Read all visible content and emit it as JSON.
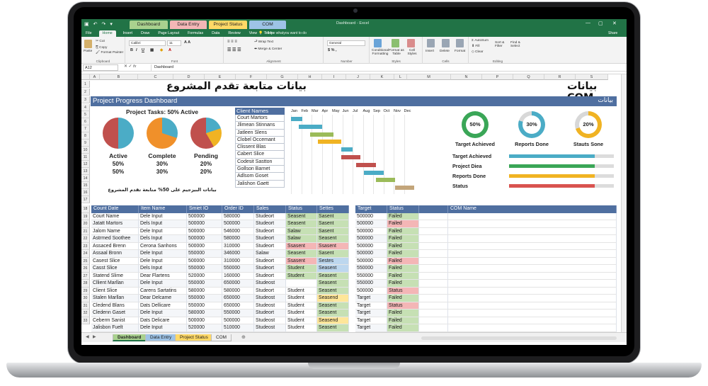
{
  "app": {
    "window_title": "Dashboard - Excel",
    "context_tabs": [
      {
        "label": "Dashboard",
        "color": "#a9d18e"
      },
      {
        "label": "Data Entry",
        "color": "#f4b6b6"
      },
      {
        "label": "Project Status",
        "color": "#ffd966"
      },
      {
        "label": "COM",
        "color": "#9dc3e6"
      }
    ],
    "user": "Share"
  },
  "menu": [
    "File",
    "Home",
    "Insert",
    "Draw",
    "Page Layout",
    "Formulas",
    "Data",
    "Review",
    "View",
    "Help"
  ],
  "menu_tell": "Tell me whatyou want to do",
  "ribbon": {
    "clipboard": {
      "label": "Clipboard",
      "paste": "Paste",
      "cut": "Cut",
      "copy": "Copy",
      "format_painter": "Format Painter"
    },
    "font": {
      "label": "Font",
      "name": "Calibri",
      "size": "11"
    },
    "alignment": {
      "label": "Alignment",
      "wrap": "Wrap Text",
      "merge": "Merge & Center"
    },
    "number": {
      "label": "Number",
      "format": "General"
    },
    "styles": {
      "label": "Styles",
      "cond": "Conditional Formatting",
      "table": "Format as Table",
      "cell": "Cell Styles"
    },
    "cells": {
      "label": "Cells",
      "insert": "Insert",
      "delete": "Delete",
      "format": "Format"
    },
    "editing": {
      "label": "Editing",
      "autosum": "AutoSum",
      "fill": "Fill",
      "clear": "Clear",
      "sort": "Sort & Filter",
      "find": "Find & Select"
    }
  },
  "formula_bar": {
    "cell": "A12",
    "fx": "fx",
    "value": "Dashboard"
  },
  "columns": [
    "A",
    "B",
    "C",
    "D",
    "E",
    "F",
    "G",
    "H",
    "I",
    "J",
    "K",
    "L",
    "M",
    "N",
    "P",
    "Q",
    "R",
    "S"
  ],
  "rows": [
    "1",
    "2",
    "3",
    "4",
    "5",
    "6",
    "7",
    "8",
    "9",
    "10",
    "11",
    "12",
    "13",
    "14",
    "15",
    "16",
    "17",
    "18",
    "19",
    "20",
    "21",
    "22",
    "23",
    "24",
    "25",
    "26",
    "27",
    "28",
    "29",
    "30",
    "31",
    "32",
    "33"
  ],
  "dashboard": {
    "title_ar": "بيانات متابعة تقدم المشروع",
    "title_com": "بيانات COM",
    "band_title": "Project Progress Dashboard",
    "band_right": "بيانات",
    "tasks_title": "Project Tasks: 50% Active",
    "pies": [
      {
        "label": "Active",
        "v1": "50%",
        "v2": "50%"
      },
      {
        "label": "Complete",
        "v1": "30%",
        "v2": "30%"
      },
      {
        "label": "Pending",
        "v1": "20%",
        "v2": "20%"
      }
    ],
    "pies_note": "بيانات البيزجيم على 50% متابعة تقدم المشروع",
    "clients_header": "Client Names",
    "clients": [
      "Court Martors",
      "Jlimean Stinnans",
      "Jatleen Slens",
      "Clobel Occemant",
      "Clissent Blas",
      "Cabert Slice",
      "Codesit Sastton",
      "Gollson Barnet",
      "Adlsom Goset",
      "Jalishon Gaett"
    ],
    "gantt_months": [
      "Jan",
      "Feb",
      "Mar",
      "Apr",
      "May",
      "Jun",
      "Jul",
      "Aug",
      "Sep",
      "Oct",
      "Nov",
      "Dec"
    ],
    "gantt_tasks": [
      {
        "start": 0,
        "end": 1.5,
        "color": "#4bacc6"
      },
      {
        "start": 1,
        "end": 4,
        "color": "#4bacc6"
      },
      {
        "start": 2.5,
        "end": 5.5,
        "color": "#9bbb59"
      },
      {
        "start": 3.5,
        "end": 6.5,
        "color": "#f0b323"
      },
      {
        "start": 6.5,
        "end": 8,
        "color": "#4bacc6"
      },
      {
        "start": 6.5,
        "end": 9,
        "color": "#c0504d"
      },
      {
        "start": 8.5,
        "end": 11,
        "color": "#c0504d"
      },
      {
        "start": 9.5,
        "end": 12,
        "color": "#4bacc6"
      },
      {
        "start": 11,
        "end": 13.5,
        "color": "#9bbb59"
      },
      {
        "start": 13.5,
        "end": 16,
        "color": "#c3a57a"
      }
    ],
    "gauges": [
      {
        "value": "50%",
        "label": "Target Achieved",
        "pct": 50,
        "color": "#3aa657"
      },
      {
        "value": "30%",
        "label": "Reports Done",
        "pct": 30,
        "color": "#4bacc6"
      },
      {
        "value": "20%",
        "label": "Stauts Sone",
        "pct": 20,
        "color": "#f0b323"
      }
    ],
    "progress": [
      {
        "label": "Target Achieved",
        "pct": 82,
        "color": "#4bacc6"
      },
      {
        "label": "Project Diea",
        "pct": 82,
        "color": "#3aa657"
      },
      {
        "label": "Reports Done",
        "pct": 82,
        "color": "#f0b323"
      },
      {
        "label": "Status",
        "pct": 82,
        "color": "#d9534f"
      }
    ]
  },
  "table": {
    "headers": [
      "Count Date",
      "Item Name",
      "Smiet IO",
      "Order ID",
      "Sales",
      "Status",
      "Settes"
    ],
    "rows": [
      [
        "Court Name",
        "Dele Input",
        "500000",
        "580000",
        "Studeort",
        "Seasent",
        "Sasent"
      ],
      [
        "Jatatt Martors",
        "Dels Input",
        "500000",
        "500000",
        "Studeort",
        "Seasent",
        "Sasent"
      ],
      [
        "Jalom Name",
        "Dele Input",
        "500000",
        "546000",
        "Studeort",
        "Salaw",
        "Sasent"
      ],
      [
        "Astrmed Soothee",
        "Dels Input",
        "500000",
        "580000",
        "Studeort",
        "Salaw",
        "Seasent"
      ],
      [
        "Assaced Brenn",
        "Cerona Sanhons",
        "500000",
        "310000",
        "Studeort",
        "Ssasent",
        "Ssasent"
      ],
      [
        "Assaal Bronn",
        "Dele Input",
        "550000",
        "346000",
        "Salaw",
        "Seasent",
        "Sasent"
      ],
      [
        "Casest Slice",
        "Dele Input",
        "500000",
        "310000",
        "Studeort",
        "Ssasent",
        "Sestes"
      ],
      [
        "Casst Slice",
        "Dels Input",
        "550000",
        "550000",
        "Studeort",
        "Student",
        "Seasent"
      ],
      [
        "Statend Slime",
        "Dear Flartens",
        "520000",
        "160000",
        "Studeort",
        "Student",
        "Seasent"
      ],
      [
        "Cllient Marllan",
        "Dele Input",
        "550000",
        "650000",
        "Studeost",
        "",
        "Seasent"
      ],
      [
        "Client Slice",
        "Carens Sartatins",
        "580000",
        "580000",
        "Studeort",
        "Student",
        "Seasent"
      ],
      [
        "Stalen Marllan",
        "Dear Delcame",
        "550000",
        "650000",
        "Studeost",
        "Student",
        "Seasend"
      ],
      [
        "Cledend Blans",
        "Dats Dellicare",
        "550000",
        "650000",
        "Studeost",
        "Student",
        "Seasent"
      ],
      [
        "Cledenn Gaset",
        "Dele Input",
        "580000",
        "550000",
        "Studeort",
        "Student",
        "Seasent"
      ],
      [
        "Ceberm Sanist",
        "Dats Delicare",
        "500000",
        "500000",
        "Studeost",
        "Student",
        "Seasend"
      ],
      [
        "Jalisbon Fuelt",
        "Dele Input",
        "520000",
        "510000",
        "Studeost",
        "Student",
        "Seasent"
      ]
    ],
    "status_colors": [
      "#c6e0b4",
      "#c6e0b4",
      "#c6e0b4",
      "#c6e0b4",
      "#f4b6b6",
      "#c6e0b4",
      "#f4b6b6",
      "#c6e0b4",
      "#c6e0b4",
      "#ffffff",
      "#ffffff",
      "#ffffff",
      "#ffffff",
      "#ffffff",
      "#ffffff",
      "#ffffff"
    ],
    "settes_colors": [
      "#c6e0b4",
      "#c6e0b4",
      "#c6e0b4",
      "#c6e0b4",
      "#f4b6b6",
      "#c6e0b4",
      "#bdd7ee",
      "#bdd7ee",
      "#c6e0b4",
      "#c6e0b4",
      "#c6e0b4",
      "#ffe699",
      "#c6e0b4",
      "#c6e0b4",
      "#ffe699",
      "#c6e0b4"
    ]
  },
  "table2": {
    "headers": [
      "Target",
      "Status",
      "",
      "COM Name"
    ],
    "rows": [
      [
        "500000",
        "Failed"
      ],
      [
        "500000",
        "Failed"
      ],
      [
        "500000",
        "Failed"
      ],
      [
        "500000",
        "Failed"
      ],
      [
        "500000",
        "Failed"
      ],
      [
        "500000",
        "Failed"
      ],
      [
        "500000",
        "Failed"
      ],
      [
        "550000",
        "Failed"
      ],
      [
        "550000",
        "Failed"
      ],
      [
        "550000",
        "Failed"
      ],
      [
        "500000",
        "Status"
      ],
      [
        "Target",
        "Failed"
      ],
      [
        "Target",
        "Status"
      ],
      [
        "Target",
        "Failed"
      ],
      [
        "Target",
        "Failed"
      ],
      [
        "Target",
        "Failed"
      ]
    ],
    "status_colors": [
      "#c6e0b4",
      "#f4b6b6",
      "#c6e0b4",
      "#c6e0b4",
      "#c6e0b4",
      "#c6e0b4",
      "#f4b6b6",
      "#c6e0b4",
      "#c6e0b4",
      "#c6e0b4",
      "#f4b6b6",
      "#c6e0b4",
      "#f4b6b6",
      "#c6e0b4",
      "#c6e0b4",
      "#c6e0b4"
    ]
  },
  "sheets": [
    {
      "label": "Dashboard",
      "color": "#a9d18e",
      "active": true
    },
    {
      "label": "Data Entry",
      "color": "#9dc3e6",
      "active": false
    },
    {
      "label": "Project Status",
      "color": "#ffd966",
      "active": false
    },
    {
      "label": "COM",
      "color": "#f0f0f0",
      "active": false
    }
  ]
}
